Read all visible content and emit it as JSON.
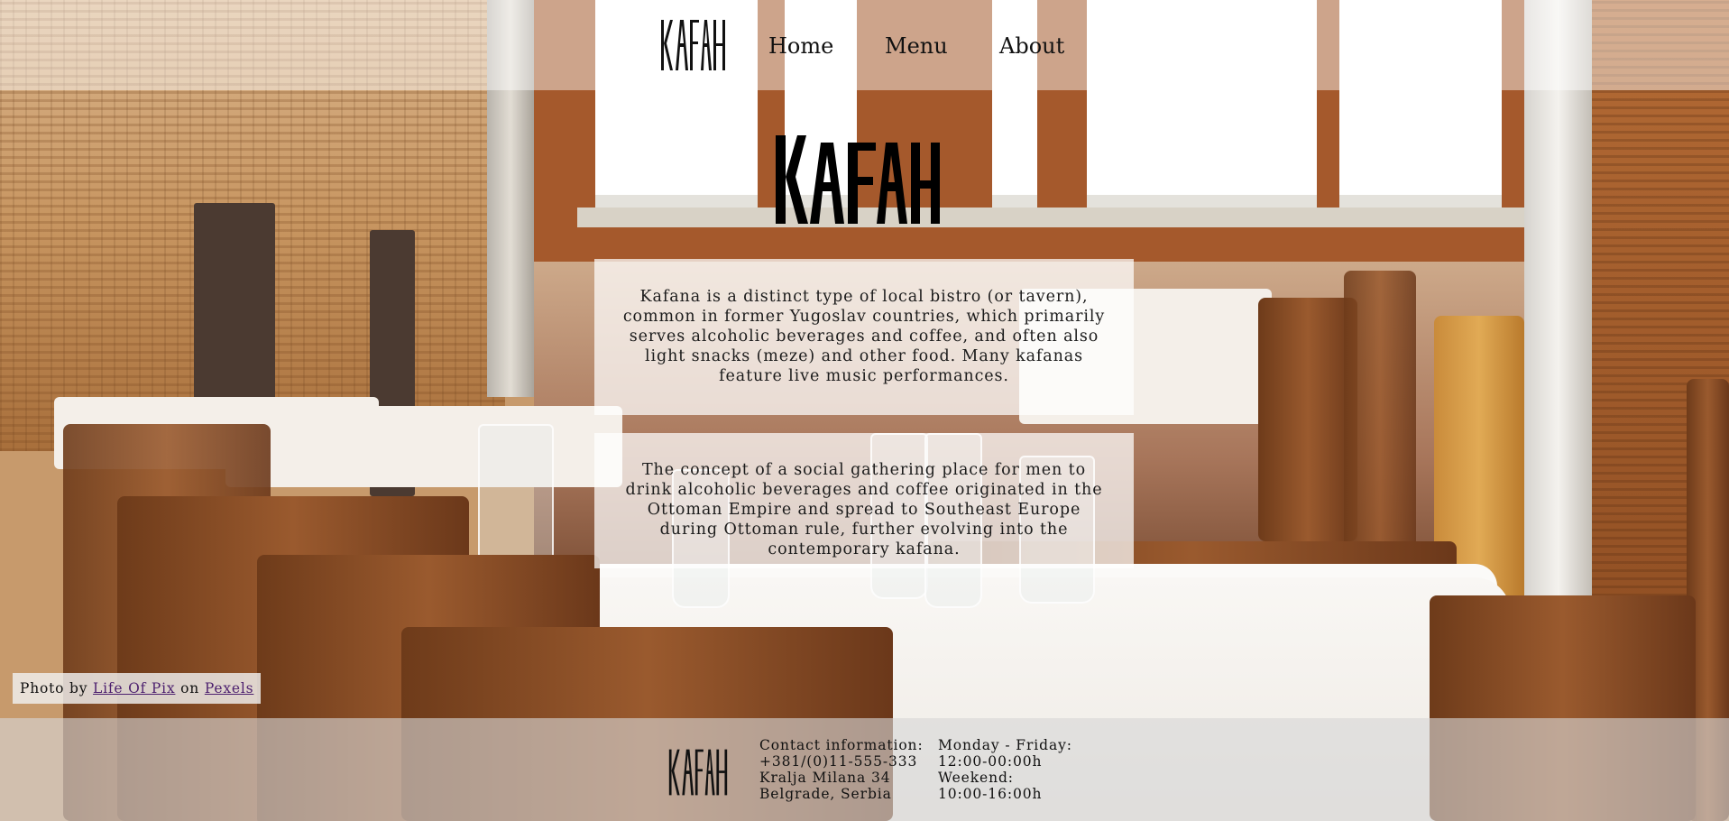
{
  "brand": {
    "name": "Kafana",
    "logo_text": "KAFANA"
  },
  "nav": {
    "items": [
      {
        "label": "Home"
      },
      {
        "label": "Menu"
      },
      {
        "label": "About"
      }
    ]
  },
  "hero": {
    "paragraph_1": "Kafana is a distinct type of local bistro (or tavern), common in former Yugoslav countries, which primarily serves alcoholic beverages and coffee, and often also light snacks (meze) and other food. Many kafanas feature live music performances.",
    "paragraph_2": "The concept of a social gathering place for men to drink alcoholic beverages and coffee originated in the Ottoman Empire and spread to Southeast Europe during Ottoman rule, further evolving into the contemporary kafana."
  },
  "credit": {
    "prefix": "Photo by",
    "author": "Life Of Pix",
    "middle": "on",
    "site": "Pexels"
  },
  "footer": {
    "contact": {
      "heading": "Contact information:",
      "phone": "+381/(0)11-555-333",
      "street": "Kralja Milana 34",
      "city": "Belgrade, Serbia"
    },
    "hours": {
      "weekday_label": "Monday - Friday:",
      "weekday_hours": "12:00-00:00h",
      "weekend_label": "Weekend:",
      "weekend_hours": "10:00-16:00h"
    }
  },
  "colors": {
    "text": "#111111",
    "link_visited": "#4c1f6e"
  }
}
